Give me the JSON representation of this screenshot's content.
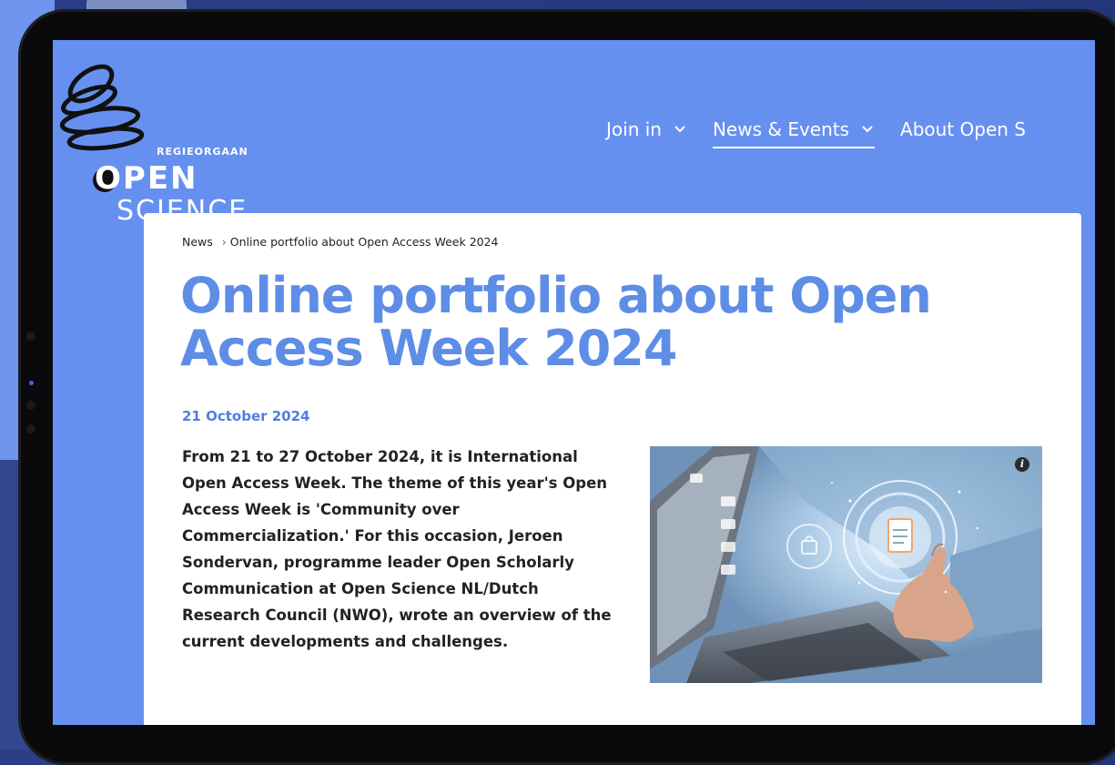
{
  "logo": {
    "small": "REGIEORGAAN",
    "main": "OPEN",
    "sub": "SCIENCE"
  },
  "nav": {
    "items": [
      {
        "label": "Join in",
        "has_dropdown": true
      },
      {
        "label": "News & Events",
        "has_dropdown": true,
        "active": true
      },
      {
        "label": "About Open S",
        "has_dropdown": false
      }
    ]
  },
  "breadcrumb": {
    "home": "News",
    "separator": "›",
    "current": "Online portfolio about Open Access Week 2024"
  },
  "article": {
    "title": "Online portfolio about Open Access Week 2024",
    "date": "21 October 2024",
    "body": "From 21 to 27 October 2024, it is International Open Access Week. The theme of this year's Open Access Week is 'Community over Commercialization.' For this occasion, Jeroen Sondervan, programme leader Open Scholarly Communication at Open Science NL/Dutch Research Council (NWO), wrote an overview of the current developments and challenges."
  },
  "image": {
    "info_icon": "info-icon",
    "info_glyph": "i"
  },
  "colors": {
    "screen_bg": "#6690f0",
    "title": "#5e8de6",
    "date": "#4f7ddd"
  }
}
